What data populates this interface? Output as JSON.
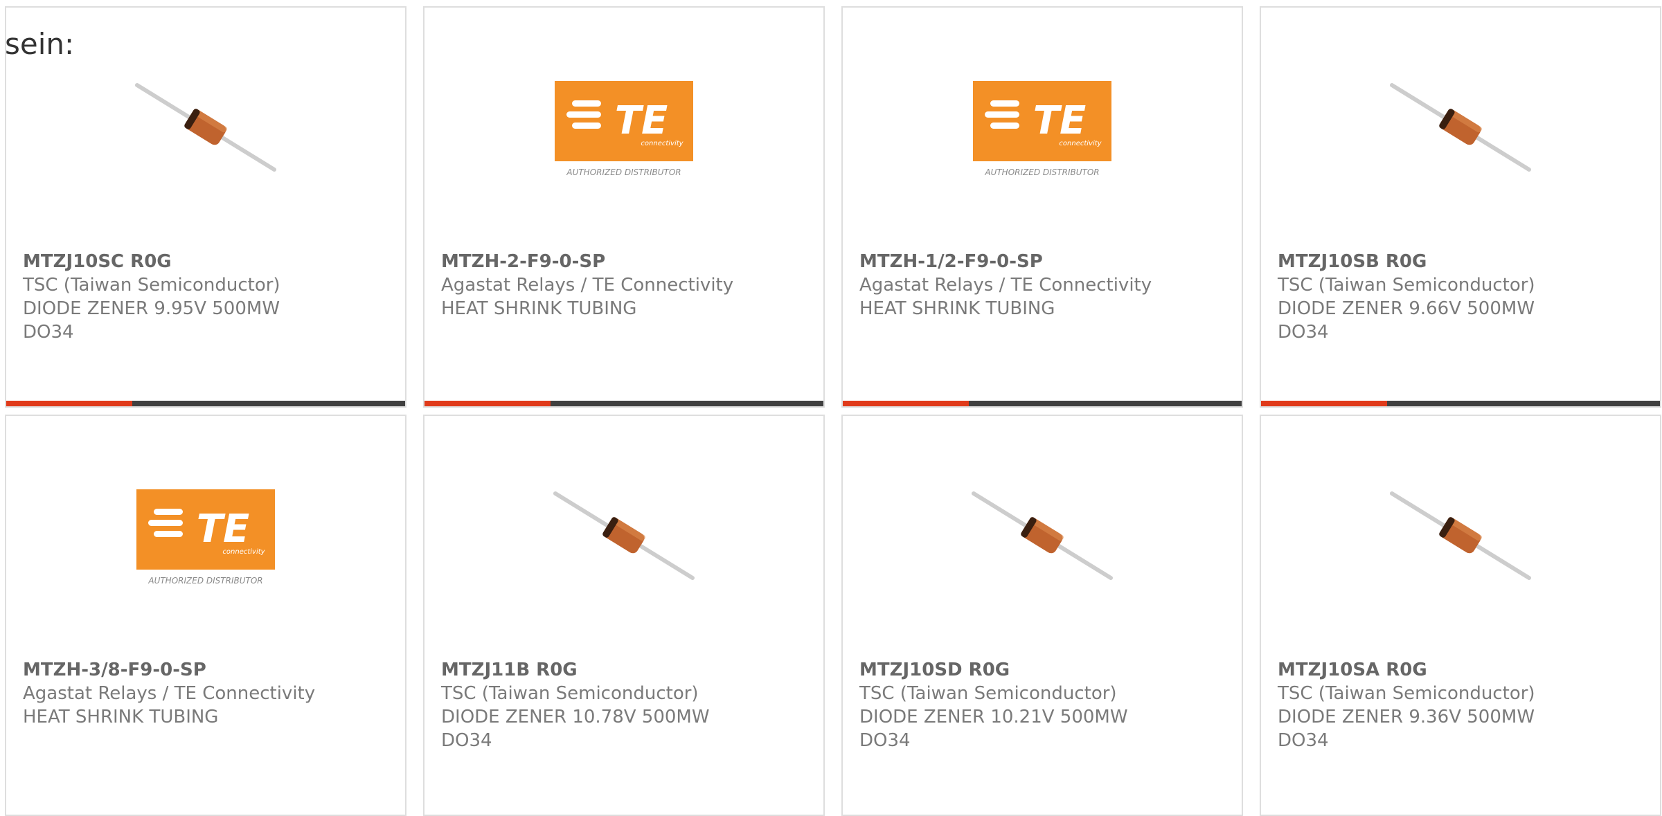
{
  "intro": "sein:",
  "colors": {
    "accent_bar": "#e03a1a",
    "dark_bar": "#404040",
    "te_orange": "#f39026",
    "diode_body": "#c0632e"
  },
  "cards": [
    {
      "part": "MTZJ10SC R0G",
      "maker": "TSC (Taiwan Semiconductor)",
      "desc": "DIODE ZENER 9.95V 500MW",
      "pkg": "DO34",
      "image": "diode-image"
    },
    {
      "part": "MTZH-2-F9-0-SP",
      "maker": "Agastat Relays / TE Connectivity",
      "desc": "HEAT SHRINK TUBING",
      "pkg": "",
      "image": "te-logo-image"
    },
    {
      "part": "MTZH-1/2-F9-0-SP",
      "maker": "Agastat Relays / TE Connectivity",
      "desc": "HEAT SHRINK TUBING",
      "pkg": "",
      "image": "te-logo-image"
    },
    {
      "part": "MTZJ10SB R0G",
      "maker": "TSC (Taiwan Semiconductor)",
      "desc": "DIODE ZENER 9.66V 500MW",
      "pkg": "DO34",
      "image": "diode-image"
    },
    {
      "part": "MTZH-3/8-F9-0-SP",
      "maker": "Agastat Relays / TE Connectivity",
      "desc": "HEAT SHRINK TUBING",
      "pkg": "",
      "image": "te-logo-image"
    },
    {
      "part": "MTZJ11B R0G",
      "maker": "TSC (Taiwan Semiconductor)",
      "desc": "DIODE ZENER 10.78V 500MW",
      "pkg": "DO34",
      "image": "diode-image"
    },
    {
      "part": "MTZJ10SD R0G",
      "maker": "TSC (Taiwan Semiconductor)",
      "desc": "DIODE ZENER 10.21V 500MW",
      "pkg": "DO34",
      "image": "diode-image"
    },
    {
      "part": "MTZJ10SA R0G",
      "maker": "TSC (Taiwan Semiconductor)",
      "desc": "DIODE ZENER 9.36V 500MW",
      "pkg": "DO34",
      "image": "diode-image"
    }
  ],
  "te_logo": {
    "wordmark": "TE",
    "sub": "connectivity",
    "tagline": "AUTHORIZED DISTRIBUTOR"
  }
}
